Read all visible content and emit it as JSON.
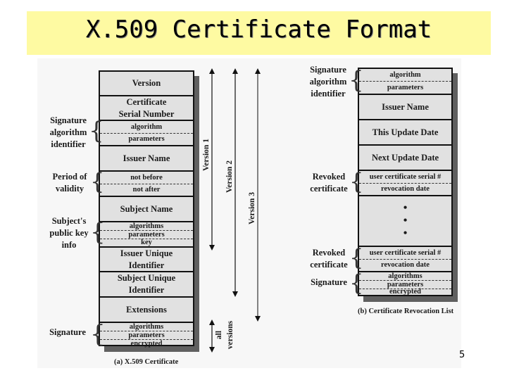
{
  "slide": {
    "title": "X.509 Certificate Format",
    "page_number": "5"
  },
  "certificate": {
    "caption": "(a) X.509 Certificate",
    "fields": [
      {
        "label": "Version"
      },
      {
        "label": "Certificate Serial Number"
      },
      {
        "sub": [
          "algorithm",
          "parameters"
        ]
      },
      {
        "label": "Issuer Name"
      },
      {
        "sub": [
          "not before",
          "not after"
        ]
      },
      {
        "label": "Subject Name"
      },
      {
        "sub": [
          "algorithms",
          "parameters",
          "key"
        ]
      },
      {
        "label": "Issuer Unique Identifier"
      },
      {
        "label": "Subject Unique Identifier"
      },
      {
        "label": "Extensions"
      },
      {
        "sub": [
          "algorithms",
          "parameters",
          "encrypted"
        ]
      }
    ],
    "f0": "Version",
    "f1a": "Certificate",
    "f1b": "Serial Number",
    "f2a": "algorithm",
    "f2b": "parameters",
    "f3": "Issuer Name",
    "f4a": "not before",
    "f4b": "not after",
    "f5": "Subject Name",
    "f6a": "algorithms",
    "f6b": "parameters",
    "f6c": "key",
    "f7a": "Issuer Unique",
    "f7b": "Identifier",
    "f8a": "Subject Unique",
    "f8b": "Identifier",
    "f9": "Extensions",
    "f10a": "algorithms",
    "f10b": "parameters",
    "f10c": "encrypted",
    "groups": {
      "sig_alg_1": "Signature",
      "sig_alg_2": "algorithm",
      "sig_alg_3": "identifier",
      "validity_1": "Period of",
      "validity_2": "validity",
      "pubkey_1": "Subject's",
      "pubkey_2": "public key",
      "pubkey_3": "info",
      "signature": "Signature"
    },
    "versions": {
      "v1": "Version 1",
      "v2": "Version 2",
      "v3": "Version 3",
      "all_1": "all",
      "all_2": "versions"
    }
  },
  "crl": {
    "caption": "(b) Certificate Revocation List",
    "f0a": "algorithm",
    "f0b": "parameters",
    "f1": "Issuer Name",
    "f2": "This Update Date",
    "f3": "Next Update Date",
    "f4a": "user certificate serial #",
    "f4b": "revocation date",
    "ellipsis": "•",
    "f6a": "user certificate serial #",
    "f6b": "revocation date",
    "f7a": "algorithms",
    "f7b": "parameters",
    "f7c": "encrypted",
    "groups": {
      "sig_alg_1": "Signature",
      "sig_alg_2": "algorithm",
      "sig_alg_3": "identifier",
      "revoked_1a": "Revoked",
      "revoked_1b": "certificate",
      "revoked_2a": "Revoked",
      "revoked_2b": "certificate",
      "signature": "Signature"
    }
  }
}
